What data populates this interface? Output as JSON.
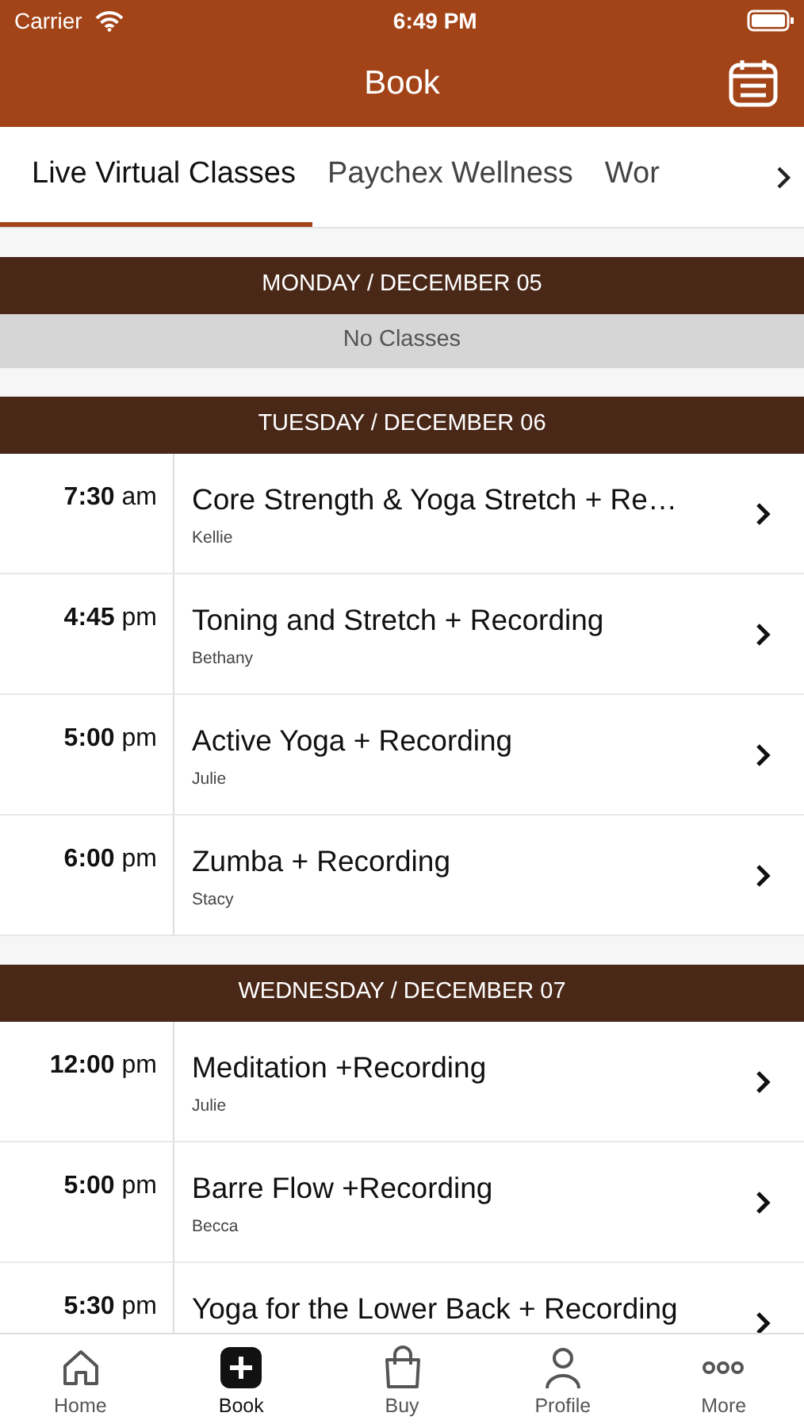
{
  "status_bar": {
    "carrier": "Carrier",
    "time": "6:49 PM"
  },
  "header": {
    "title": "Book"
  },
  "tabs": [
    {
      "label": "Live Virtual Classes",
      "selected": true
    },
    {
      "label": "Paychex Wellness",
      "selected": false
    },
    {
      "label": "Wor",
      "selected": false
    }
  ],
  "days": [
    {
      "title": "MONDAY / DECEMBER 05",
      "empty_text": "No Classes"
    },
    {
      "title": "TUESDAY / DECEMBER 06",
      "classes": [
        {
          "time": "**7:30** am",
          "name": "Core Strength & Yoga Stretch + Re…",
          "instructor": "Kellie"
        },
        {
          "time": "**4:45** pm",
          "name": "Toning and Stretch + Recording",
          "instructor": "Bethany"
        },
        {
          "time": "**5:00** pm",
          "name": "Active Yoga + Recording",
          "instructor": "Julie"
        },
        {
          "time": "**6:00** pm",
          "name": "Zumba + Recording",
          "instructor": "Stacy"
        }
      ]
    },
    {
      "title": "WEDNESDAY / DECEMBER 07",
      "classes": [
        {
          "time": "**12:00** pm",
          "name": "Meditation +Recording",
          "instructor": "Julie"
        },
        {
          "time": "**5:00** pm",
          "name": "Barre Flow +Recording",
          "instructor": "Becca"
        },
        {
          "time": "**5:30** pm",
          "name": "Yoga for the Lower Back + Recording"
        }
      ]
    }
  ],
  "tab_bar": [
    {
      "label": "Home",
      "selected": false
    },
    {
      "label": "Book",
      "selected": true
    },
    {
      "label": "Buy",
      "selected": false
    },
    {
      "label": "Profile",
      "selected": false
    },
    {
      "label": "More",
      "selected": false
    }
  ]
}
